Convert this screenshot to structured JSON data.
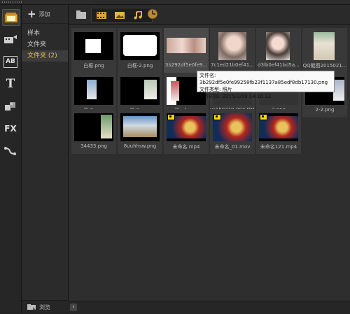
{
  "library": {
    "add_label": "添加",
    "items": [
      {
        "label": "样本",
        "selected": false
      },
      {
        "label": "文件夹",
        "selected": false
      },
      {
        "label": "文件夹 (2)",
        "selected": true
      }
    ],
    "browse_label": "浏览"
  },
  "toolbar": {
    "buttons": [
      {
        "icon": "media-library-icon"
      },
      {
        "icon": "instant-project-icon"
      },
      {
        "icon": "title-ab-icon"
      },
      {
        "icon": "text-t-icon"
      },
      {
        "icon": "transition-icon"
      },
      {
        "icon": "fx-filter-icon"
      },
      {
        "icon": "motion-path-icon"
      }
    ],
    "fx_label": "FX",
    "ab_label": "AB",
    "t_label": "T"
  },
  "filters": {
    "folder_icon": "folder-icon",
    "video_icon": "film-icon",
    "photo_icon": "photo-icon",
    "audio_icon": "music-note-icon",
    "clock_icon": "clock-icon"
  },
  "media": [
    {
      "caption": "白框.png",
      "kind": "image"
    },
    {
      "caption": "白框-2.png",
      "kind": "image"
    },
    {
      "caption": "3b292df5e0fe9...",
      "kind": "image"
    },
    {
      "caption": "7c1ed21b0ef41...",
      "kind": "image"
    },
    {
      "caption": "d3lb0ef41bd5a...",
      "kind": "image"
    },
    {
      "caption": "QQ截图2015021...",
      "kind": "image"
    },
    {
      "caption": "竖-2.png",
      "kind": "image"
    },
    {
      "caption": "竖-3.png",
      "kind": "image"
    },
    {
      "caption": "竖~4.png",
      "kind": "image"
    },
    {
      "caption": "vs150319-004.BMP",
      "kind": "image"
    },
    {
      "caption": "2.png",
      "kind": "image"
    },
    {
      "caption": "2-2.png",
      "kind": "image"
    },
    {
      "caption": "34433.png",
      "kind": "image"
    },
    {
      "caption": "8uuhhsw.png",
      "kind": "image"
    },
    {
      "caption": "未命名.mp4",
      "kind": "video"
    },
    {
      "caption": "未命名_01.mov",
      "kind": "video"
    },
    {
      "caption": "未命名121.mp4",
      "kind": "video"
    }
  ],
  "tooltip": {
    "line1": "文件名: 3b292df5e0fe99258fb23f1137a85edf8db17130.png",
    "line2": "文件类型: 照片",
    "line3": "文件时间: 2015/3/19 14:16:13"
  },
  "colors": {
    "accent_yellow": "#e2c44a",
    "video_badge": "#ffd400",
    "background": "#2e2e2e"
  }
}
